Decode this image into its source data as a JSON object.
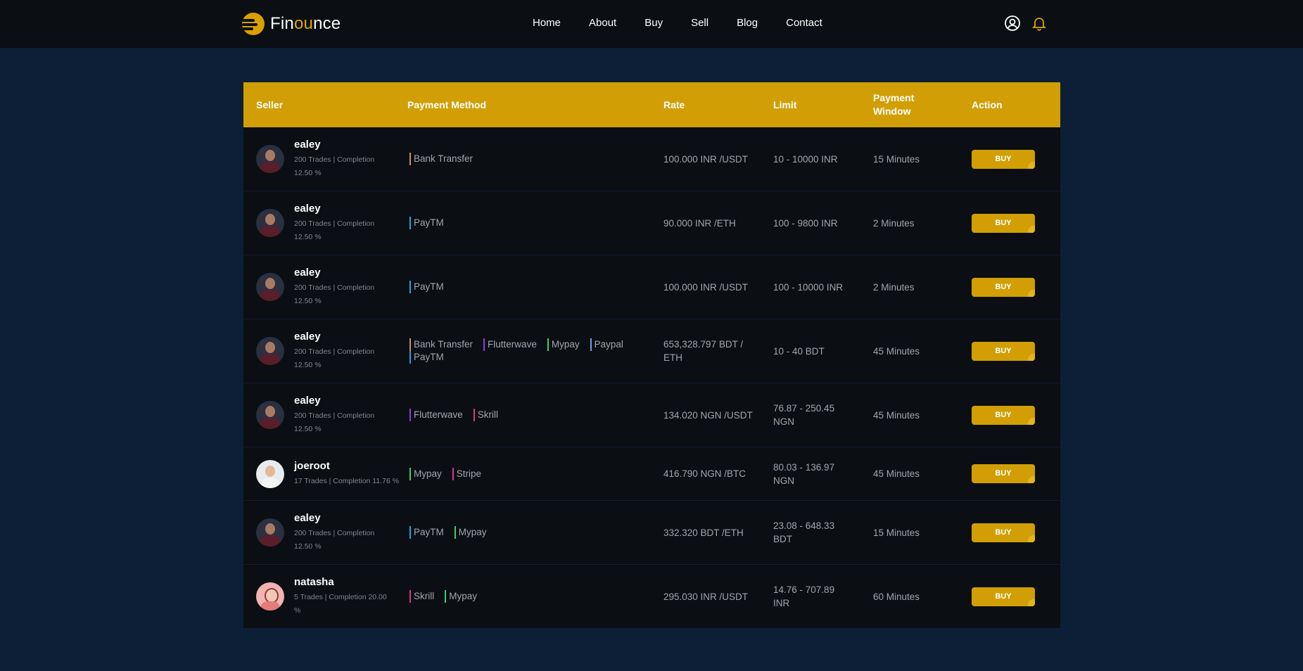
{
  "brand": {
    "name_pre": "Fin",
    "name_accent": "ou",
    "name_post": "nce",
    "accent": "#d19f05"
  },
  "nav": [
    "Home",
    "About",
    "Buy",
    "Sell",
    "Blog",
    "Contact"
  ],
  "tools": {
    "account": "user-circle-icon",
    "notifications": "bell-icon"
  },
  "table": {
    "headers": [
      "Seller",
      "Payment Method",
      "Rate",
      "Limit",
      "Payment Window",
      "Action"
    ],
    "rows": [
      {
        "name": "ealey",
        "meta1": "200 Trades | Completion",
        "meta2": "12.50 %",
        "avatar": "dark",
        "methods": [
          {
            "label": "Bank Transfer",
            "color": "#c98b73"
          }
        ],
        "rate": "100.000 INR /USDT",
        "limit": "10 - 10000 INR",
        "window": "15 Minutes",
        "action": "BUY"
      },
      {
        "name": "ealey",
        "meta1": "200 Trades | Completion",
        "meta2": "12.50 %",
        "avatar": "dark",
        "methods": [
          {
            "label": "PayTM",
            "color": "#22a5e6"
          }
        ],
        "rate": "90.000 INR /ETH",
        "limit": "100 - 9800 INR",
        "window": "2 Minutes",
        "action": "BUY"
      },
      {
        "name": "ealey",
        "meta1": "200 Trades | Completion",
        "meta2": "12.50 %",
        "avatar": "dark",
        "methods": [
          {
            "label": "PayTM",
            "color": "#22a5e6"
          }
        ],
        "rate": "100.000 INR /USDT",
        "limit": "100 - 10000 INR",
        "window": "2 Minutes",
        "action": "BUY"
      },
      {
        "name": "ealey",
        "meta1": "200 Trades | Completion",
        "meta2": "12.50 %",
        "avatar": "dark",
        "methods": [
          {
            "label": "Bank Transfer",
            "color": "#c98b73"
          },
          {
            "label": "Flutterwave",
            "color": "#8b3fe0"
          },
          {
            "label": "Mypay",
            "color": "#3ccf6c"
          },
          {
            "label": "Paypal",
            "color": "#6ba0e8"
          },
          {
            "label": "PayTM",
            "color": "#22a5e6"
          }
        ],
        "rate": "653,328.797 BDT / ETH",
        "limit": "10 - 40 BDT",
        "window": "45 Minutes",
        "action": "BUY"
      },
      {
        "name": "ealey",
        "meta1": "200 Trades | Completion",
        "meta2": "12.50 %",
        "avatar": "dark",
        "methods": [
          {
            "label": "Flutterwave",
            "color": "#8b3fe0"
          },
          {
            "label": "Skrill",
            "color": "#e0338f"
          }
        ],
        "rate": "134.020 NGN /USDT",
        "limit": "76.87 - 250.45 NGN",
        "window": "45 Minutes",
        "action": "BUY"
      },
      {
        "name": "joeroot",
        "meta1": "17 Trades | Completion 11.76 %",
        "meta2": "",
        "avatar": "light",
        "methods": [
          {
            "label": "Mypay",
            "color": "#3ccf6c"
          },
          {
            "label": "Stripe",
            "color": "#e0338f"
          }
        ],
        "rate": "416.790 NGN /BTC",
        "limit": "80.03 - 136.97 NGN",
        "window": "45 Minutes",
        "action": "BUY"
      },
      {
        "name": "ealey",
        "meta1": "200 Trades | Completion",
        "meta2": "12.50 %",
        "avatar": "dark",
        "methods": [
          {
            "label": "PayTM",
            "color": "#22a5e6"
          },
          {
            "label": "Mypay",
            "color": "#3ccf6c"
          }
        ],
        "rate": "332.320 BDT /ETH",
        "limit": "23.08 - 648.33 BDT",
        "window": "15 Minutes",
        "action": "BUY"
      },
      {
        "name": "natasha",
        "meta1": "5 Trades | Completion 20.00",
        "meta2": "%",
        "avatar": "pink",
        "methods": [
          {
            "label": "Skrill",
            "color": "#e0338f"
          },
          {
            "label": "Mypay",
            "color": "#3ccf6c"
          }
        ],
        "rate": "295.030 INR /USDT",
        "limit": "14.76 - 707.89 INR",
        "window": "60 Minutes",
        "action": "BUY"
      }
    ]
  }
}
